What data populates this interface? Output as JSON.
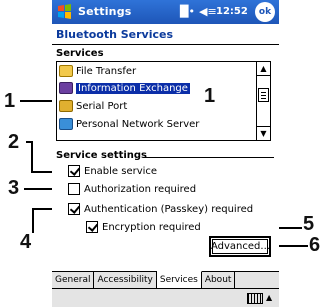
{
  "titlebar": {
    "app_title": "Settings",
    "time": "12:52",
    "ok_label": "ok"
  },
  "page": {
    "title": "Bluetooth Services"
  },
  "services": {
    "header": "Services",
    "items": [
      {
        "label": "File Transfer",
        "icon": "folder-icon",
        "selected": false
      },
      {
        "label": "Information Exchange",
        "icon": "exchange-icon",
        "selected": true
      },
      {
        "label": "Serial Port",
        "icon": "serial-port-icon",
        "selected": false
      },
      {
        "label": "Personal Network Server",
        "icon": "network-icon",
        "selected": false
      }
    ]
  },
  "settings": {
    "header": "Service settings",
    "enable_service": {
      "label": "Enable service",
      "checked": true
    },
    "authorization": {
      "label": "Authorization required",
      "checked": false
    },
    "authentication": {
      "label": "Authentication (Passkey) required",
      "checked": true
    },
    "encryption": {
      "label": "Encryption required",
      "checked": true
    },
    "advanced_label": "Advanced..."
  },
  "tabs": [
    {
      "label": "General",
      "active": false
    },
    {
      "label": "Accessibility",
      "active": false
    },
    {
      "label": "Services",
      "active": true
    },
    {
      "label": "About",
      "active": false
    }
  ],
  "callouts": {
    "c1_left": "1",
    "c1_right": "1",
    "c2": "2",
    "c3": "3",
    "c4": "4",
    "c5": "5",
    "c6": "6"
  },
  "colors": {
    "titlebar": "#1e56b8",
    "selection": "#0b2ea8",
    "title_text": "#0b3a9c"
  }
}
